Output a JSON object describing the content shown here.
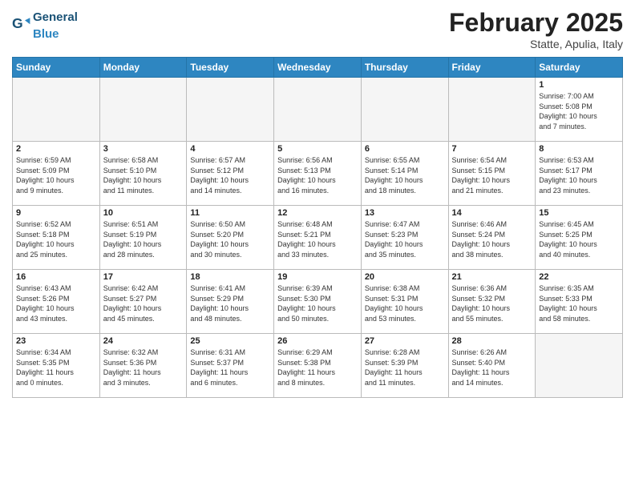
{
  "header": {
    "logo": {
      "general": "General",
      "blue": "Blue"
    },
    "title": "February 2025",
    "subtitle": "Statte, Apulia, Italy"
  },
  "calendar": {
    "days_of_week": [
      "Sunday",
      "Monday",
      "Tuesday",
      "Wednesday",
      "Thursday",
      "Friday",
      "Saturday"
    ],
    "weeks": [
      [
        {
          "day": "",
          "info": ""
        },
        {
          "day": "",
          "info": ""
        },
        {
          "day": "",
          "info": ""
        },
        {
          "day": "",
          "info": ""
        },
        {
          "day": "",
          "info": ""
        },
        {
          "day": "",
          "info": ""
        },
        {
          "day": "1",
          "info": "Sunrise: 7:00 AM\nSunset: 5:08 PM\nDaylight: 10 hours\nand 7 minutes."
        }
      ],
      [
        {
          "day": "2",
          "info": "Sunrise: 6:59 AM\nSunset: 5:09 PM\nDaylight: 10 hours\nand 9 minutes."
        },
        {
          "day": "3",
          "info": "Sunrise: 6:58 AM\nSunset: 5:10 PM\nDaylight: 10 hours\nand 11 minutes."
        },
        {
          "day": "4",
          "info": "Sunrise: 6:57 AM\nSunset: 5:12 PM\nDaylight: 10 hours\nand 14 minutes."
        },
        {
          "day": "5",
          "info": "Sunrise: 6:56 AM\nSunset: 5:13 PM\nDaylight: 10 hours\nand 16 minutes."
        },
        {
          "day": "6",
          "info": "Sunrise: 6:55 AM\nSunset: 5:14 PM\nDaylight: 10 hours\nand 18 minutes."
        },
        {
          "day": "7",
          "info": "Sunrise: 6:54 AM\nSunset: 5:15 PM\nDaylight: 10 hours\nand 21 minutes."
        },
        {
          "day": "8",
          "info": "Sunrise: 6:53 AM\nSunset: 5:17 PM\nDaylight: 10 hours\nand 23 minutes."
        }
      ],
      [
        {
          "day": "9",
          "info": "Sunrise: 6:52 AM\nSunset: 5:18 PM\nDaylight: 10 hours\nand 25 minutes."
        },
        {
          "day": "10",
          "info": "Sunrise: 6:51 AM\nSunset: 5:19 PM\nDaylight: 10 hours\nand 28 minutes."
        },
        {
          "day": "11",
          "info": "Sunrise: 6:50 AM\nSunset: 5:20 PM\nDaylight: 10 hours\nand 30 minutes."
        },
        {
          "day": "12",
          "info": "Sunrise: 6:48 AM\nSunset: 5:21 PM\nDaylight: 10 hours\nand 33 minutes."
        },
        {
          "day": "13",
          "info": "Sunrise: 6:47 AM\nSunset: 5:23 PM\nDaylight: 10 hours\nand 35 minutes."
        },
        {
          "day": "14",
          "info": "Sunrise: 6:46 AM\nSunset: 5:24 PM\nDaylight: 10 hours\nand 38 minutes."
        },
        {
          "day": "15",
          "info": "Sunrise: 6:45 AM\nSunset: 5:25 PM\nDaylight: 10 hours\nand 40 minutes."
        }
      ],
      [
        {
          "day": "16",
          "info": "Sunrise: 6:43 AM\nSunset: 5:26 PM\nDaylight: 10 hours\nand 43 minutes."
        },
        {
          "day": "17",
          "info": "Sunrise: 6:42 AM\nSunset: 5:27 PM\nDaylight: 10 hours\nand 45 minutes."
        },
        {
          "day": "18",
          "info": "Sunrise: 6:41 AM\nSunset: 5:29 PM\nDaylight: 10 hours\nand 48 minutes."
        },
        {
          "day": "19",
          "info": "Sunrise: 6:39 AM\nSunset: 5:30 PM\nDaylight: 10 hours\nand 50 minutes."
        },
        {
          "day": "20",
          "info": "Sunrise: 6:38 AM\nSunset: 5:31 PM\nDaylight: 10 hours\nand 53 minutes."
        },
        {
          "day": "21",
          "info": "Sunrise: 6:36 AM\nSunset: 5:32 PM\nDaylight: 10 hours\nand 55 minutes."
        },
        {
          "day": "22",
          "info": "Sunrise: 6:35 AM\nSunset: 5:33 PM\nDaylight: 10 hours\nand 58 minutes."
        }
      ],
      [
        {
          "day": "23",
          "info": "Sunrise: 6:34 AM\nSunset: 5:35 PM\nDaylight: 11 hours\nand 0 minutes."
        },
        {
          "day": "24",
          "info": "Sunrise: 6:32 AM\nSunset: 5:36 PM\nDaylight: 11 hours\nand 3 minutes."
        },
        {
          "day": "25",
          "info": "Sunrise: 6:31 AM\nSunset: 5:37 PM\nDaylight: 11 hours\nand 6 minutes."
        },
        {
          "day": "26",
          "info": "Sunrise: 6:29 AM\nSunset: 5:38 PM\nDaylight: 11 hours\nand 8 minutes."
        },
        {
          "day": "27",
          "info": "Sunrise: 6:28 AM\nSunset: 5:39 PM\nDaylight: 11 hours\nand 11 minutes."
        },
        {
          "day": "28",
          "info": "Sunrise: 6:26 AM\nSunset: 5:40 PM\nDaylight: 11 hours\nand 14 minutes."
        },
        {
          "day": "",
          "info": ""
        }
      ]
    ]
  }
}
